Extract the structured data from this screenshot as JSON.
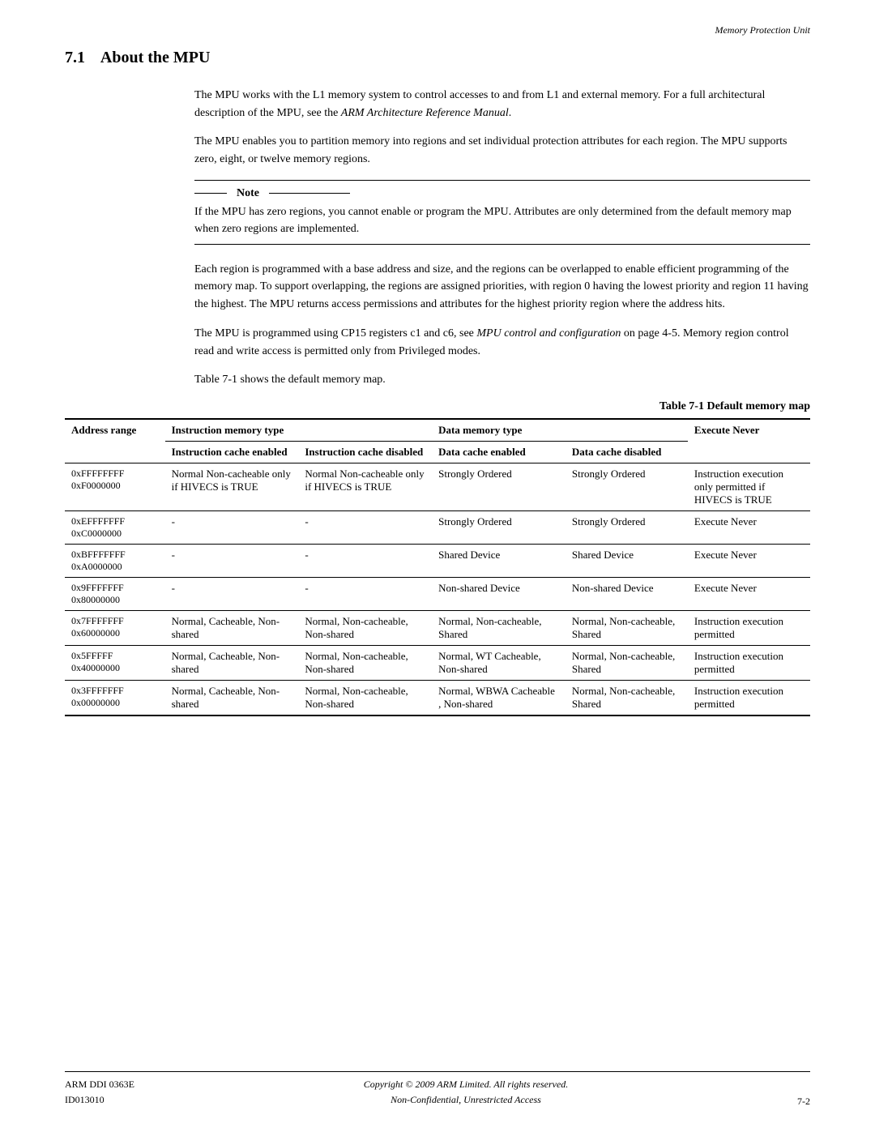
{
  "header": {
    "right_text": "Memory Protection Unit"
  },
  "section": {
    "number": "7.1",
    "title": "About the MPU"
  },
  "paragraphs": [
    "The MPU works with the L1 memory system to control accesses to and from L1 and external memory. For a full architectural description of the MPU, see the ARM Architecture Reference Manual.",
    "The MPU enables you to partition memory into regions and set individual protection attributes for each region. The MPU supports zero, eight, or twelve memory regions.",
    "Each region is programmed with a base address and size, and the regions can be overlapped to enable efficient programming of the memory map. To support overlapping, the regions are assigned priorities, with region 0 having the lowest priority and region 11 having the highest. The MPU returns access permissions and attributes for the highest priority region where the address hits.",
    "The MPU is programmed using CP15 registers c1 and c6, see MPU control and configuration on page 4-5. Memory region control read and write access is permitted only from Privileged modes.",
    "Table 7-1 shows the default memory map."
  ],
  "note": {
    "label": "Note",
    "text": "If the MPU has zero regions, you cannot enable or program the MPU. Attributes are only determined from the default memory map when zero regions are implemented."
  },
  "table": {
    "caption": "Table 7-1 Default memory map",
    "col_headers": {
      "address_range": "Address range",
      "inst_group": "Instruction memory type",
      "data_group": "Data memory type",
      "execute_never": "Execute Never",
      "inst_cache_enabled": "Instruction cache enabled",
      "inst_cache_disabled": "Instruction cache disabled",
      "data_cache_enabled": "Data cache enabled",
      "data_cache_disabled": "Data cache disabled"
    },
    "rows": [
      {
        "addr1": "0xFFFFFFFF",
        "addr2": "0xF0000000",
        "inst_ce": "Normal Non-cacheable only if HIVECS is TRUE",
        "inst_cd": "Normal Non-cacheable only if HIVECS is TRUE",
        "data_ce": "Strongly Ordered",
        "data_cd": "Strongly Ordered",
        "exec": "Instruction execution only permitted if HIVECS is TRUE"
      },
      {
        "addr1": "0xEFFFFFFF",
        "addr2": "0xC0000000",
        "inst_ce": "-",
        "inst_cd": "-",
        "data_ce": "Strongly Ordered",
        "data_cd": "Strongly Ordered",
        "exec": "Execute Never"
      },
      {
        "addr1": "0xBFFFFFFF",
        "addr2": "0xA0000000",
        "inst_ce": "-",
        "inst_cd": "-",
        "data_ce": "Shared Device",
        "data_cd": "Shared Device",
        "exec": "Execute Never"
      },
      {
        "addr1": "0x9FFFFFFF",
        "addr2": "0x80000000",
        "inst_ce": "-",
        "inst_cd": "-",
        "data_ce": "Non-shared Device",
        "data_cd": "Non-shared Device",
        "exec": "Execute Never"
      },
      {
        "addr1": "0x7FFFFFFF",
        "addr2": "0x60000000",
        "inst_ce": "Normal, Cacheable, Non-shared",
        "inst_cd": "Normal, Non-cacheable, Non-shared",
        "data_ce": "Normal, Non-cacheable, Shared",
        "data_cd": "Normal, Non-cacheable, Shared",
        "exec": "Instruction execution permitted"
      },
      {
        "addr1": "0x5FFFFF",
        "addr2": "0x40000000",
        "inst_ce": "Normal, Cacheable, Non-shared",
        "inst_cd": "Normal, Non-cacheable, Non-shared",
        "data_ce": "Normal, WT Cacheable, Non-shared",
        "data_cd": "Normal, Non-cacheable, Shared",
        "exec": "Instruction execution permitted"
      },
      {
        "addr1": "0x3FFFFFFF",
        "addr2": "0x00000000",
        "inst_ce": "Normal, Cacheable, Non-shared",
        "inst_cd": "Normal, Non-cacheable, Non-shared",
        "data_ce": "Normal, WBWA Cacheable , Non-shared",
        "data_cd": "Normal, Non-cacheable, Shared",
        "exec": "Instruction execution permitted"
      }
    ]
  },
  "footer": {
    "left_line1": "ARM DDI 0363E",
    "left_line2": "ID013010",
    "center_line1": "Copyright © 2009 ARM Limited. All rights reserved.",
    "center_line2": "Non-Confidential, Unrestricted Access",
    "right": "7-2"
  }
}
